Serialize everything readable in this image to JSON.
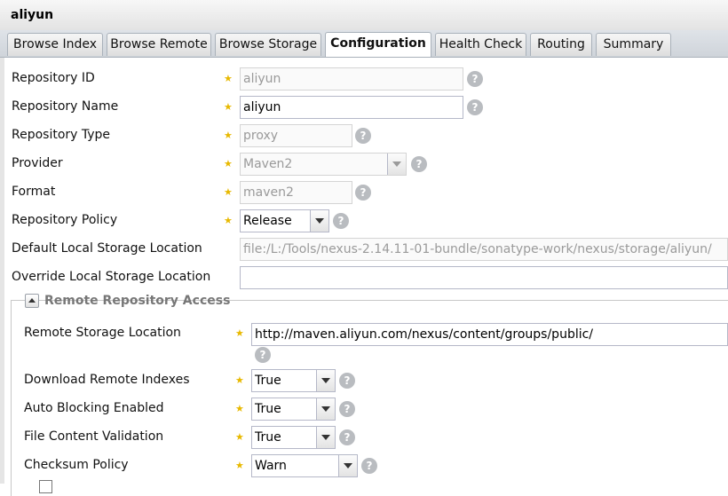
{
  "window": {
    "title": "aliyun"
  },
  "tabs": [
    {
      "label": "Browse Index"
    },
    {
      "label": "Browse Remote"
    },
    {
      "label": "Browse Storage"
    },
    {
      "label": "Configuration",
      "active": true
    },
    {
      "label": "Health Check"
    },
    {
      "label": "Routing"
    },
    {
      "label": "Summary"
    }
  ],
  "form": {
    "repository_id": {
      "label": "Repository ID",
      "value": "aliyun"
    },
    "repository_name": {
      "label": "Repository Name",
      "value": "aliyun"
    },
    "repository_type": {
      "label": "Repository Type",
      "value": "proxy"
    },
    "provider": {
      "label": "Provider",
      "value": "Maven2"
    },
    "format": {
      "label": "Format",
      "value": "maven2"
    },
    "repository_policy": {
      "label": "Repository Policy",
      "value": "Release"
    },
    "default_local_storage": {
      "label": "Default Local Storage Location",
      "value": "file:/L:/Tools/nexus-2.14.11-01-bundle/sonatype-work/nexus/storage/aliyun/"
    },
    "override_local_storage": {
      "label": "Override Local Storage Location",
      "value": ""
    }
  },
  "remote_access": {
    "legend": "Remote Repository Access",
    "remote_storage_location": {
      "label": "Remote Storage Location",
      "value": "http://maven.aliyun.com/nexus/content/groups/public/"
    },
    "download_remote_indexes": {
      "label": "Download Remote Indexes",
      "value": "True"
    },
    "auto_blocking_enabled": {
      "label": "Auto Blocking Enabled",
      "value": "True"
    },
    "file_content_validation": {
      "label": "File Content Validation",
      "value": "True"
    },
    "checksum_policy": {
      "label": "Checksum Policy",
      "value": "Warn"
    }
  },
  "icons": {
    "required": "star-icon",
    "help": "help-icon",
    "collapse": "collapse-icon",
    "dropdown": "chevron-down-icon"
  },
  "colors": {
    "required_star": "#e8b900",
    "disabled_text": "#9a9a9a",
    "help_icon": "#b9bcc0"
  }
}
